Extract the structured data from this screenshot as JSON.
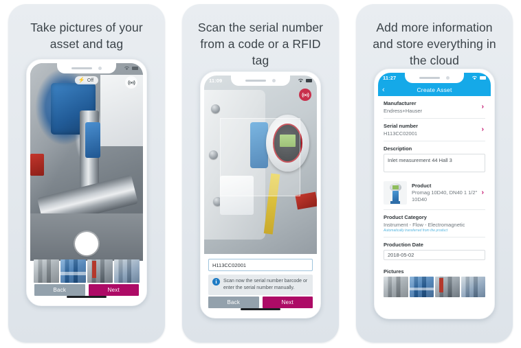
{
  "panels": [
    {
      "title": "Take pictures of your asset and tag",
      "phone": {
        "status_time": "",
        "flash_label": "Off",
        "flash_icon": "flash-icon",
        "rfid_icon": "rfid-wave-icon",
        "shutter": "shutter-button",
        "thumbnails": [
          "thumbnail-1",
          "thumbnail-2",
          "thumbnail-3",
          "thumbnail-4"
        ],
        "back_label": "Back",
        "next_label": "Next"
      }
    },
    {
      "title": "Scan the serial number from a code or a RFID tag",
      "phone": {
        "status_time": "11:09",
        "rfid_icon": "rfid-wave-icon",
        "serial_value": "H113CC02001",
        "info_icon": "info-icon",
        "info_text": "Scan now the serial number barcode or enter the serial number manually.",
        "back_label": "Back",
        "next_label": "Next"
      }
    },
    {
      "title": "Add more information and store everything in the cloud",
      "phone": {
        "status_time": "11:27",
        "header_title": "Create Asset",
        "back_icon": "chevron-left-icon",
        "rows": [
          {
            "label": "Manufacturer",
            "value": "Endress+Hauser",
            "chevron": "›"
          },
          {
            "label": "Serial number",
            "value": "H113CC02001",
            "chevron": "›"
          }
        ],
        "description_label": "Description",
        "description_value": "Inlet measurement 44 Hall 3",
        "product_label": "Product",
        "product_desc": "Promag 10D40, DN40 1 1/2\" 10D40",
        "product_chevron": "›",
        "category_label": "Product Category",
        "category_value": "Instrument - Flow - Electromagnetic",
        "category_hint": "Automatically transferred from the product",
        "production_label": "Production Date",
        "production_value": "2018-05-02",
        "pictures_label": "Pictures",
        "pictures": [
          "picture-1",
          "picture-2",
          "picture-3",
          "picture-4"
        ]
      }
    }
  ],
  "colors": {
    "card_bg": "#e5eaef",
    "header_blue": "#15a9e8",
    "accent_magenta": "#ad0b66",
    "chevron_magenta": "#c20a68",
    "back_grey": "#93a1ac",
    "hint_blue": "#56b6e0"
  }
}
